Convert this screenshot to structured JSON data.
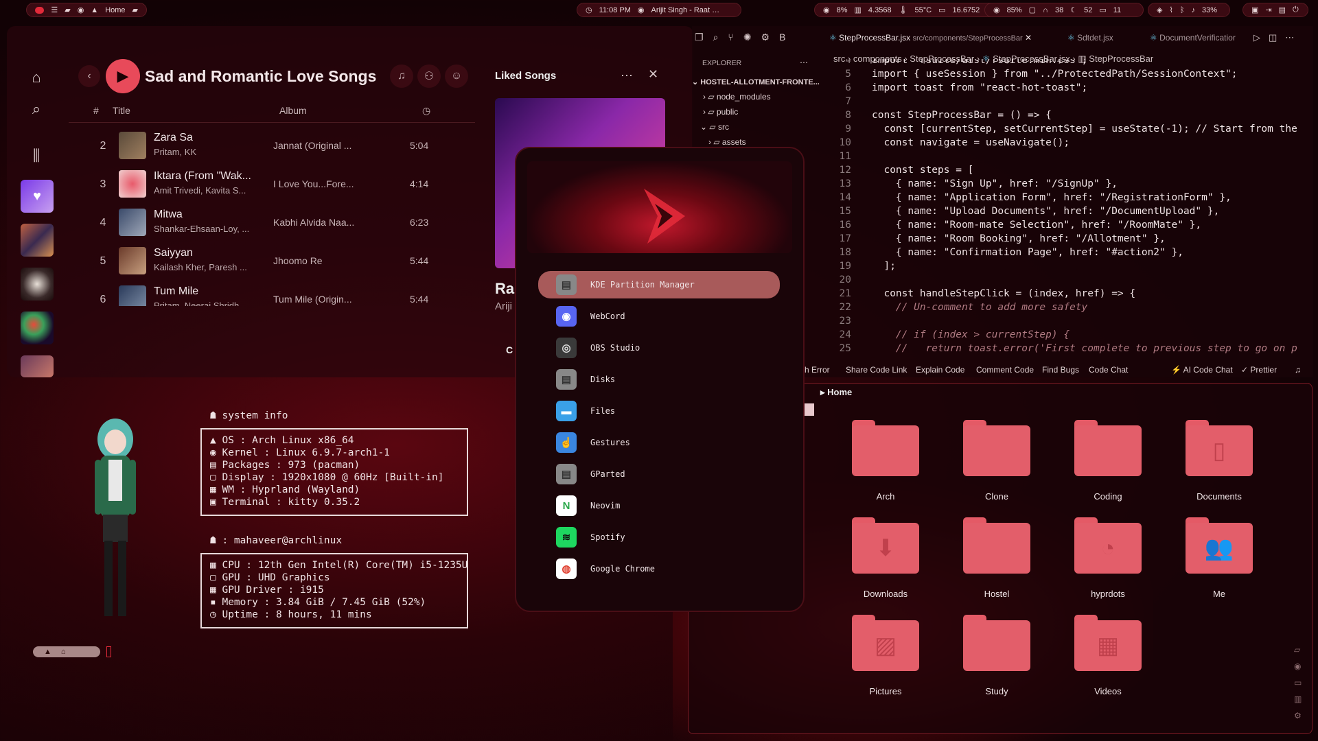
{
  "topbar": {
    "home_label": "Home",
    "clock": "11:08 PM",
    "now_playing": "Arijit Singh - Raat …",
    "cpu": "8%",
    "mem": "4.3568",
    "temp": "55°C",
    "disk": "16.6752",
    "battery_pct": "85%",
    "headset": "38",
    "brightness": "52",
    "kbd": "11",
    "volume": "33%"
  },
  "spotify": {
    "playlist_title": "Sad and Romantic Love Songs",
    "col_num": "#",
    "col_title": "Title",
    "col_album": "Album",
    "tracks": [
      {
        "n": "2",
        "title": "Zara Sa",
        "artist": "Pritam, KK",
        "album": "Jannat (Original ...",
        "dur": "5:04"
      },
      {
        "n": "3",
        "title": "Iktara (From \"Wak...",
        "artist": "Amit Trivedi, Kavita S...",
        "album": "I Love You...Fore...",
        "dur": "4:14"
      },
      {
        "n": "4",
        "title": "Mitwa",
        "artist": "Shankar-Ehsaan-Loy, ...",
        "album": "Kabhi Alvida Naa...",
        "dur": "6:23"
      },
      {
        "n": "5",
        "title": "Saiyyan",
        "artist": "Kailash Kher, Paresh ...",
        "album": "Jhoomo Re",
        "dur": "5:44"
      },
      {
        "n": "6",
        "title": "Tum Mile",
        "artist": "Pritam, Neeraj Shridh...",
        "album": "Tum Mile (Origin...",
        "dur": "5:44"
      }
    ],
    "liked_title": "Liked Songs",
    "liked_song_partial": "Ra",
    "liked_artist_partial": "Ariji",
    "liked_partial_c": "C"
  },
  "editor": {
    "tabs": [
      {
        "name": "StepProcessBar.jsx",
        "path": "src/components/StepProcessBar"
      },
      {
        "name": "Sdtdet.jsx"
      },
      {
        "name": "DocumentVerificatior"
      }
    ],
    "explorer_label": "EXPLORER",
    "project": "HOSTEL-ALLOTMENT-FRONTE...",
    "tree": [
      "node_modules",
      "public",
      "src",
      "assets"
    ],
    "breadcrumb": [
      "src",
      "components",
      "StepProcessBar",
      "StepProcessBar.jsx",
      "StepProcessBar"
    ],
    "lines": [
      {
        "n": "4",
        "code": "import 'rsuite/dist/rsuite.min.css';"
      },
      {
        "n": "5",
        "code": "import { useSession } from \"../ProtectedPath/SessionContext\";"
      },
      {
        "n": "6",
        "code": "import toast from \"react-hot-toast\";"
      },
      {
        "n": "7",
        "code": ""
      },
      {
        "n": "8",
        "code": "const StepProcessBar = () => {"
      },
      {
        "n": "9",
        "code": "  const [currentStep, setCurrentStep] = useState(-1); // Start from the"
      },
      {
        "n": "10",
        "code": "  const navigate = useNavigate();"
      },
      {
        "n": "11",
        "code": ""
      },
      {
        "n": "12",
        "code": "  const steps = ["
      },
      {
        "n": "13",
        "code": "    { name: \"Sign Up\", href: \"/SignUp\" },"
      },
      {
        "n": "14",
        "code": "    { name: \"Application Form\", href: \"/RegistrationForm\" },"
      },
      {
        "n": "15",
        "code": "    { name: \"Upload Documents\", href: \"/DocumentUpload\" },"
      },
      {
        "n": "16",
        "code": "    { name: \"Room-mate Selection\", href: \"/RoomMate\" },"
      },
      {
        "n": "17",
        "code": "    { name: \"Room Booking\", href: \"/Allotment\" },"
      },
      {
        "n": "18",
        "code": "    { name: \"Confirmation Page\", href: \"#action2\" },"
      },
      {
        "n": "19",
        "code": "  ];"
      },
      {
        "n": "20",
        "code": ""
      },
      {
        "n": "21",
        "code": "  const handleStepClick = (index, href) => {"
      },
      {
        "n": "22",
        "code": "    // Un-comment to add more safety"
      },
      {
        "n": "23",
        "code": ""
      },
      {
        "n": "24",
        "code": "    // if (index > currentStep) {"
      },
      {
        "n": "25",
        "code": "    //   return toast.error('First complete to previous step to go on p"
      }
    ],
    "status": [
      "rch Error",
      "Share Code Link",
      "Explain Code",
      "Comment Code",
      "Find Bugs",
      "Code Chat",
      "AI Code Chat",
      "Prettier"
    ]
  },
  "neofetch": {
    "sys_header": "system info",
    "sys": [
      "OS : Arch Linux x86_64",
      "Kernel : Linux 6.9.7-arch1-1",
      "Packages : 973 (pacman)",
      "Display : 1920x1080 @ 60Hz [Built-in]",
      "WM : Hyprland (Wayland)",
      "Terminal : kitty 0.35.2"
    ],
    "user_header": ": mahaveer@archlinux",
    "hw": [
      "CPU : 12th Gen Intel(R) Core(TM) i5-1235U",
      "GPU : UHD Graphics",
      "GPU Driver : i915",
      "Memory : 3.84 GiB / 7.45 GiB (52%)",
      "Uptime  : 8 hours, 11 mins"
    ]
  },
  "launcher": {
    "apps": [
      {
        "name": "KDE Partition Manager",
        "icon": "disk-icon",
        "bg": "#888888",
        "fg": "#333333",
        "glyph": "▤"
      },
      {
        "name": "WebCord",
        "icon": "discord-icon",
        "bg": "#5865f2",
        "fg": "#ffffff",
        "glyph": "◉"
      },
      {
        "name": "OBS Studio",
        "icon": "obs-icon",
        "bg": "#3a3a3a",
        "fg": "#dddddd",
        "glyph": "◎"
      },
      {
        "name": "Disks",
        "icon": "disk-icon",
        "bg": "#888888",
        "fg": "#333333",
        "glyph": "▤"
      },
      {
        "name": "Files",
        "icon": "folder-icon",
        "bg": "#3aa0e8",
        "fg": "#ffffff",
        "glyph": "▬"
      },
      {
        "name": "Gestures",
        "icon": "hand-icon",
        "bg": "#3a86e0",
        "fg": "#ffffff",
        "glyph": "☝"
      },
      {
        "name": "GParted",
        "icon": "disk-icon",
        "bg": "#888888",
        "fg": "#333333",
        "glyph": "▤"
      },
      {
        "name": "Neovim",
        "icon": "neovim-icon",
        "bg": "#ffffff",
        "fg": "#2aa84a",
        "glyph": "N"
      },
      {
        "name": "Spotify",
        "icon": "spotify-icon",
        "bg": "#1ed760",
        "fg": "#111111",
        "glyph": "≋"
      },
      {
        "name": "Google Chrome",
        "icon": "chrome-icon",
        "bg": "#ffffff",
        "fg": "#e04030",
        "glyph": "◍"
      }
    ],
    "selected_index": 0
  },
  "files": {
    "location": "Home",
    "folders": [
      {
        "name": "Arch",
        "glyph": ""
      },
      {
        "name": "Clone",
        "glyph": ""
      },
      {
        "name": "Coding",
        "glyph": ""
      },
      {
        "name": "Documents",
        "glyph": "▯"
      },
      {
        "name": "Downloads",
        "glyph": "⬇"
      },
      {
        "name": "Hostel",
        "glyph": ""
      },
      {
        "name": "hyprdots",
        "glyph": "◔"
      },
      {
        "name": "Me",
        "glyph": "👥"
      },
      {
        "name": "Pictures",
        "glyph": "▨"
      },
      {
        "name": "Study",
        "glyph": ""
      },
      {
        "name": "Videos",
        "glyph": "▦"
      }
    ]
  },
  "colors": {
    "accent": "#e35e6a",
    "selected_app_bg": "#a85a5a",
    "play_button": "#e84a5a"
  }
}
